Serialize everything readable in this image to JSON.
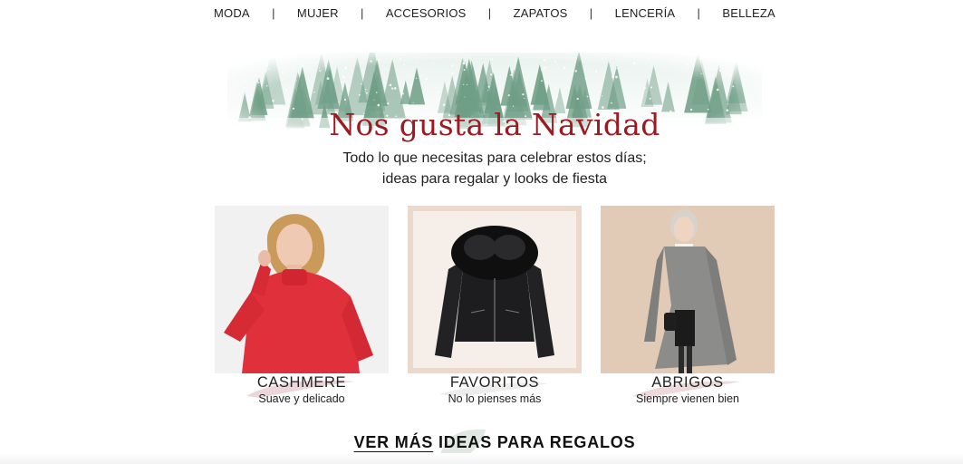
{
  "nav": {
    "items": [
      "MODA",
      "MUJER",
      "ACCESORIOS",
      "ZAPATOS",
      "LENCERÍA",
      "BELLEZA"
    ],
    "separator": "|"
  },
  "banner": {
    "title": "Nos gusta la Navidad",
    "subtitle_line1": "Todo lo que necesitas para celebrar estos días;",
    "subtitle_line2": "ideas para regalar y looks de fiesta",
    "title_color": "#9c1b22",
    "tree_color": "#6f9e86"
  },
  "cards": [
    {
      "category": "CASHMERE",
      "description": "Suave y delicado"
    },
    {
      "category": "FAVORITOS",
      "description": "No lo pienses más"
    },
    {
      "category": "ABRIGOS",
      "description": "Siempre vienen bien"
    }
  ],
  "cta": {
    "part1": "VER MÁS",
    "part2": " IDEAS PARA REGALOS"
  }
}
